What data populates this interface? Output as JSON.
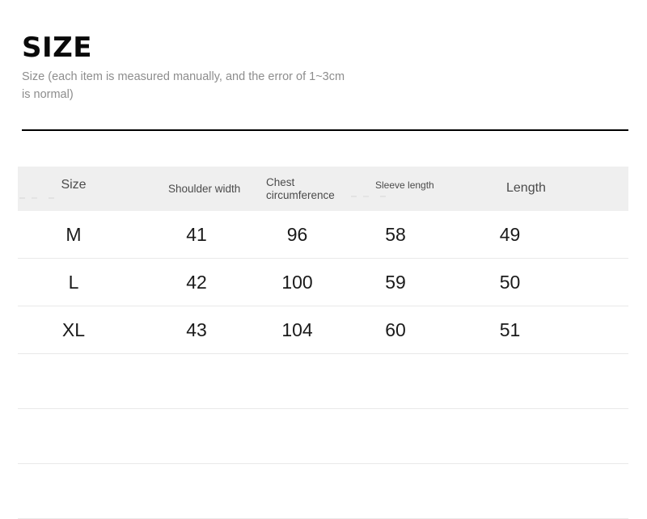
{
  "document": {
    "title": "SIZE",
    "subtitle": "Size (each item is measured manually, and the error of 1~3cm is normal)"
  },
  "table": {
    "headers": {
      "size": "Size",
      "shoulder_width": "Shoulder width",
      "chest_circumference": "Chest circumference",
      "sleeve_length": "Sleeve length",
      "length": "Length"
    },
    "rows": [
      {
        "size": "M",
        "shoulder_width": "41",
        "chest_circumference": "96",
        "sleeve_length": "58",
        "length": "49"
      },
      {
        "size": "L",
        "shoulder_width": "42",
        "chest_circumference": "100",
        "sleeve_length": "59",
        "length": "50"
      },
      {
        "size": "XL",
        "shoulder_width": "43",
        "chest_circumference": "104",
        "sleeve_length": "60",
        "length": "51"
      },
      {
        "size": "",
        "shoulder_width": "",
        "chest_circumference": "",
        "sleeve_length": "",
        "length": ""
      },
      {
        "size": "",
        "shoulder_width": "",
        "chest_circumference": "",
        "sleeve_length": "",
        "length": ""
      },
      {
        "size": "",
        "shoulder_width": "",
        "chest_circumference": "",
        "sleeve_length": "",
        "length": ""
      }
    ]
  },
  "colors": {
    "header_background": "#efefef",
    "header_text": "#4b4b4b",
    "title_text": "#0a0a0a",
    "subtitle_text": "#8d8d8d",
    "row_divider": "#e9e9e9",
    "title_rule": "#000000",
    "value_text": "#1a1a1a"
  }
}
